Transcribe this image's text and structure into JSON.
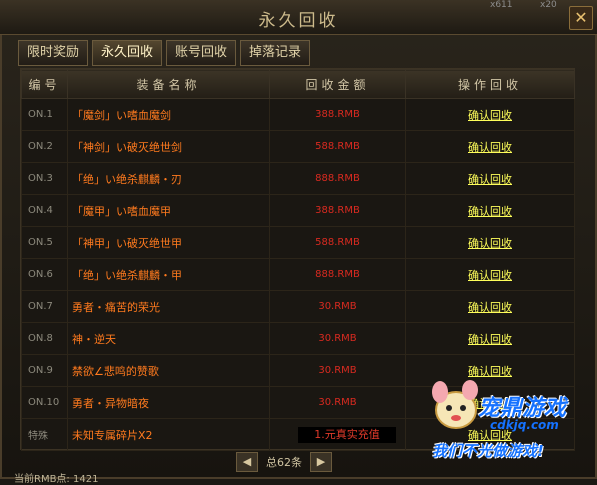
{
  "window": {
    "title": "永久回收",
    "top_text_left": "x611",
    "top_text_right": "x20",
    "close_glyph": "✕"
  },
  "tabs": [
    "限时奖励",
    "永久回收",
    "账号回收",
    "掉落记录"
  ],
  "table": {
    "headers": [
      "编号",
      "装备名称",
      "回收金额",
      "操作回收"
    ],
    "rows": [
      {
        "no": "ON.1",
        "name": "「魔剑」い嗜血魔剑",
        "price": "388.RMB",
        "action": "确认回收"
      },
      {
        "no": "ON.2",
        "name": "「神剑」い破灭绝世剑",
        "price": "588.RMB",
        "action": "确认回收"
      },
      {
        "no": "ON.3",
        "name": "「绝」い绝杀麒麟・刃",
        "price": "888.RMB",
        "action": "确认回收"
      },
      {
        "no": "ON.4",
        "name": "「魔甲」い嗜血魔甲",
        "price": "388.RMB",
        "action": "确认回收"
      },
      {
        "no": "ON.5",
        "name": "「神甲」い破灭绝世甲",
        "price": "588.RMB",
        "action": "确认回收"
      },
      {
        "no": "ON.6",
        "name": "「绝」い绝杀麒麟・甲",
        "price": "888.RMB",
        "action": "确认回收"
      },
      {
        "no": "ON.7",
        "name": "勇者・痛苦的荣光",
        "price": "30.RMB",
        "action": "确认回收"
      },
      {
        "no": "ON.8",
        "name": "神・逆天",
        "price": "30.RMB",
        "action": "确认回收"
      },
      {
        "no": "ON.9",
        "name": "禁欲∠悲鸣的赞歌",
        "price": "30.RMB",
        "action": "确认回收"
      },
      {
        "no": "ON.10",
        "name": "勇者・异物暗夜",
        "price": "30.RMB",
        "action": "确认回收"
      }
    ],
    "special": {
      "no": "特殊",
      "name": "未知专属碎片X2",
      "price": "1.元真实充值",
      "action": "确认回收"
    }
  },
  "pager": {
    "prev": "◀",
    "next": "▶",
    "total": "总62条"
  },
  "footer": {
    "rmb_points": "当前RMB点: 1421"
  },
  "watermark": {
    "name": "宠鼎游戏",
    "url": "cdkjq.com",
    "slogan": "我们不光做游戏!"
  },
  "colors": {
    "name": "#ff7a1e",
    "price": "#d92a20",
    "confirm": "#ffff5a",
    "watermark": "#1572ff"
  }
}
